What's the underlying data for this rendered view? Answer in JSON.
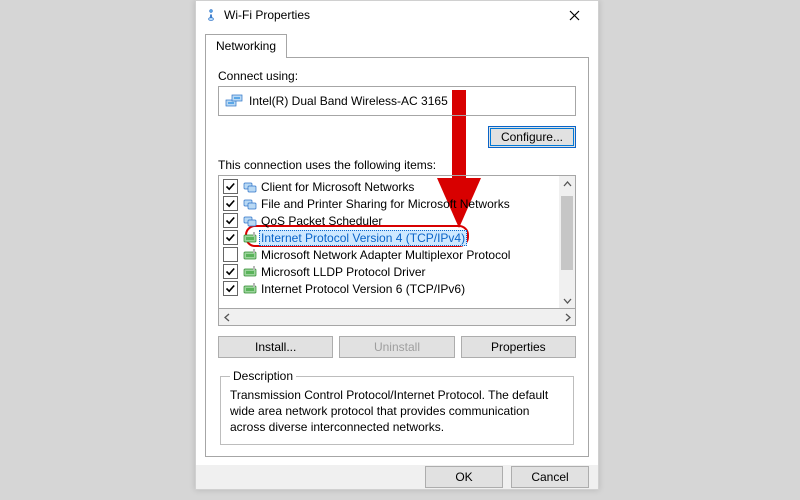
{
  "window": {
    "title": "Wi-Fi Properties"
  },
  "tab": {
    "networking": "Networking"
  },
  "connect_using_label": "Connect using:",
  "adapter": "Intel(R) Dual Band Wireless-AC 3165",
  "configure_btn": "Configure...",
  "items_label": "This connection uses the following items:",
  "items": [
    {
      "checked": true,
      "label": "Client for Microsoft Networks",
      "icon": "client"
    },
    {
      "checked": true,
      "label": "File and Printer Sharing for Microsoft Networks",
      "icon": "client"
    },
    {
      "checked": true,
      "label": "QoS Packet Scheduler",
      "icon": "client"
    },
    {
      "checked": true,
      "label": "Internet Protocol Version 4 (TCP/IPv4)",
      "icon": "protocol"
    },
    {
      "checked": false,
      "label": "Microsoft Network Adapter Multiplexor Protocol",
      "icon": "protocol"
    },
    {
      "checked": true,
      "label": "Microsoft LLDP Protocol Driver",
      "icon": "protocol"
    },
    {
      "checked": true,
      "label": "Internet Protocol Version 6 (TCP/IPv6)",
      "icon": "protocol"
    }
  ],
  "selected_index": 3,
  "buttons": {
    "install": "Install...",
    "uninstall": "Uninstall",
    "properties": "Properties",
    "ok": "OK",
    "cancel": "Cancel"
  },
  "description": {
    "legend": "Description",
    "text": "Transmission Control Protocol/Internet Protocol. The default wide area network protocol that provides communication across diverse interconnected networks."
  },
  "colors": {
    "highlight": "#0a64c8",
    "annotation_red": "#d80000"
  }
}
